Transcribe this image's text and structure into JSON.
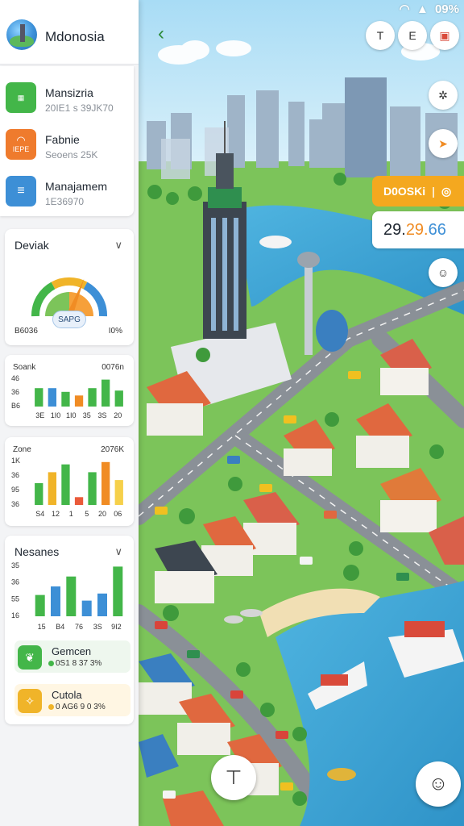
{
  "app": {
    "title": "Mdonosia"
  },
  "status_bar": {
    "battery": "09%"
  },
  "tasks": [
    {
      "name": "Mansizria",
      "value": "20IE1 s 39JK70",
      "color": "#43b649",
      "icon": "map-icon"
    },
    {
      "name": "Fabnie",
      "value": "Seoens 25K",
      "color": "#ef7b2d",
      "icon": "wifi-icon",
      "badge": "IEPE"
    },
    {
      "name": "Manajamem",
      "value": "1E36970",
      "color": "#3d8fd6",
      "icon": "list-icon"
    }
  ],
  "cards": {
    "devak": {
      "title": "Deviak",
      "gauge_label": "SAPG",
      "min_label": "B6036",
      "max_label": "I0%",
      "gauge_value": 0.62
    },
    "soank": {
      "title": "Soank",
      "head_right": "0076n",
      "y_ticks": [
        "46",
        "36",
        "B6"
      ],
      "x_ticks": [
        "3E",
        "1I0",
        "1I0",
        "35",
        "3S",
        "20"
      ]
    },
    "zone": {
      "title": "Zone",
      "head_right": "2076K",
      "y_ticks": [
        "1K",
        "36",
        "95",
        "36"
      ],
      "x_ticks": [
        "S4",
        "12",
        "1",
        "5",
        "20",
        "06"
      ]
    },
    "nesanes": {
      "title": "Nesanes",
      "y_ticks": [
        "35",
        "36",
        "55",
        "16"
      ],
      "x_ticks": [
        "15",
        "B4",
        "76",
        "3S",
        "9I2"
      ]
    }
  },
  "chart_data": [
    {
      "type": "bar",
      "title": "Soank",
      "categories": [
        "3E",
        "1I0",
        "1I0",
        "35",
        "3S",
        "20"
      ],
      "series": [
        {
          "values": [
            30,
            30,
            24,
            18,
            30,
            44,
            26
          ]
        }
      ],
      "colors": [
        "#43b649",
        "#3d8fd6",
        "#43b649",
        "#f08c24",
        "#43b649",
        "#43b649",
        "#43b649"
      ],
      "ylim": [
        0,
        50
      ]
    },
    {
      "type": "bar",
      "title": "Zone",
      "categories": [
        "S4",
        "12",
        "1",
        "5",
        "20",
        "06"
      ],
      "series": [
        {
          "values": [
            28,
            42,
            52,
            10,
            42,
            55,
            32
          ]
        }
      ],
      "colors": [
        "#43b649",
        "#f0b429",
        "#43b649",
        "#ea5a3a",
        "#43b649",
        "#f08c24",
        "#f6d04a"
      ],
      "ylim": [
        0,
        60
      ]
    },
    {
      "type": "bar",
      "title": "Nesanes",
      "categories": [
        "15",
        "B4",
        "76",
        "3S",
        "9I2"
      ],
      "series": [
        {
          "values": [
            30,
            42,
            56,
            22,
            32,
            70
          ]
        }
      ],
      "colors": [
        "#43b649",
        "#3d8fd6",
        "#43b649",
        "#3d8fd6",
        "#3d8fd6",
        "#43b649"
      ],
      "ylim": [
        0,
        75
      ]
    }
  ],
  "resources": [
    {
      "name": "Gemcen",
      "value": "0S1  8 37 3%",
      "color": "#43b649",
      "bg": "#eef7ee",
      "icon": "leaf-icon"
    },
    {
      "name": "Cutola",
      "value": "0 AG6  9 0 3%",
      "color": "#f0b429",
      "bg": "#fff6e3",
      "icon": "coin-icon"
    }
  ],
  "hud": {
    "orange_label": "D0OSKi",
    "number_value": "29.29.66",
    "number_parts": [
      "29.",
      "29.",
      "66"
    ]
  }
}
